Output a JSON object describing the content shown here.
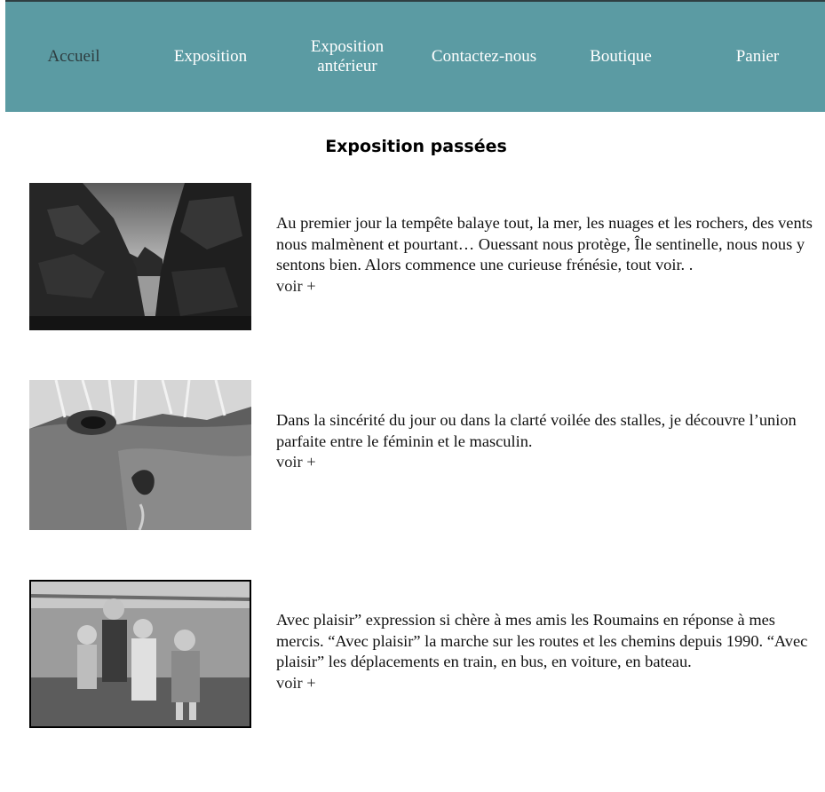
{
  "nav": {
    "items": [
      {
        "label": "Accueil",
        "active": true
      },
      {
        "label": "Exposition"
      },
      {
        "label": "Exposition\nantérieur"
      },
      {
        "label": "Contactez-nous"
      },
      {
        "label": "Boutique"
      },
      {
        "label": "Panier"
      }
    ]
  },
  "main": {
    "title": "Exposition passées",
    "exhibitions": [
      {
        "text": "Au premier jour la tempête balaye tout, la mer, les nuages et les rochers, des vents nous malmènent et pourtant… Ouessant nous protège, Île sentinelle, nous nous y sentons bien. Alors commence une curieuse frénésie, tout voir. .",
        "more": "voir +"
      },
      {
        "text": "Dans la sincérité du jour ou dans la clarté voilée des stalles, je découvre l’union parfaite entre le féminin et le masculin.",
        "more": "voir +"
      },
      {
        "text": "Avec plaisir” expression si chère à mes amis les Roumains en réponse à mes mercis. “Avec plaisir” la marche sur les routes et les chemins depuis 1990. “Avec plaisir” les déplacements en train, en bus, en voiture, en bateau.",
        "more": "voir +"
      }
    ]
  },
  "colors": {
    "nav_bg": "#5b9ba3",
    "nav_text": "#ffffff",
    "nav_active": "#2e3d40"
  }
}
